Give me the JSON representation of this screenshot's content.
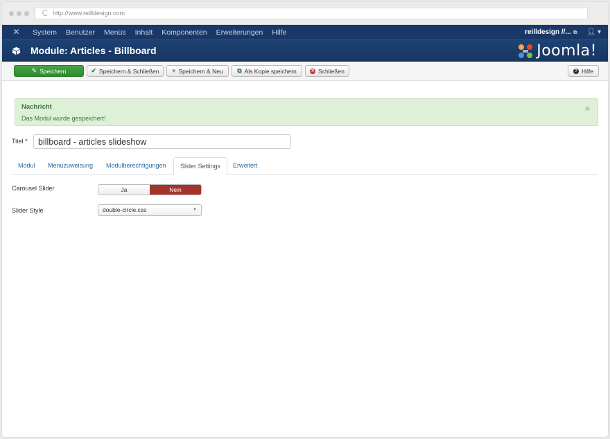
{
  "browser": {
    "url": "http://www.reilldesign.com"
  },
  "topnav": {
    "items": [
      "System",
      "Benutzer",
      "Menüs",
      "Inhalt",
      "Komponenten",
      "Erweiterungen",
      "Hilfe"
    ],
    "site_label": "reilldesign //...",
    "user_icon": "user-icon"
  },
  "header": {
    "title": "Module: Articles - Billboard",
    "brand": "Joomla!"
  },
  "toolbar": {
    "save": "Speichern",
    "save_close": "Speichern & Schließen",
    "save_new": "Speichern & Neu",
    "save_copy": "Als Kopie speichern",
    "close": "Schließen",
    "help": "Hilfe"
  },
  "message": {
    "title": "Nachricht",
    "body": "Das Modul wurde gespeichert!",
    "close": "×"
  },
  "form": {
    "title_label": "Titel *",
    "title_value": "billboard - articles slideshow",
    "tabs": [
      "Modul",
      "Menüzuweisung",
      "Modulberechtigungen",
      "Slider Settings",
      "Erweitert"
    ],
    "active_tab": "Slider Settings",
    "carousel_label": "Carousel Slider",
    "carousel_options": [
      "Ja",
      "Nein"
    ],
    "carousel_selected": "Nein",
    "style_label": "Slider Style",
    "style_value": "double-circle.css"
  },
  "colors": {
    "nav": "#1a3867",
    "header": "#1c3d6e",
    "save_green": "#3c9a3c",
    "toggle_active": "#a3332b",
    "alert_bg": "#dff0d8",
    "link": "#2a6aa8"
  }
}
